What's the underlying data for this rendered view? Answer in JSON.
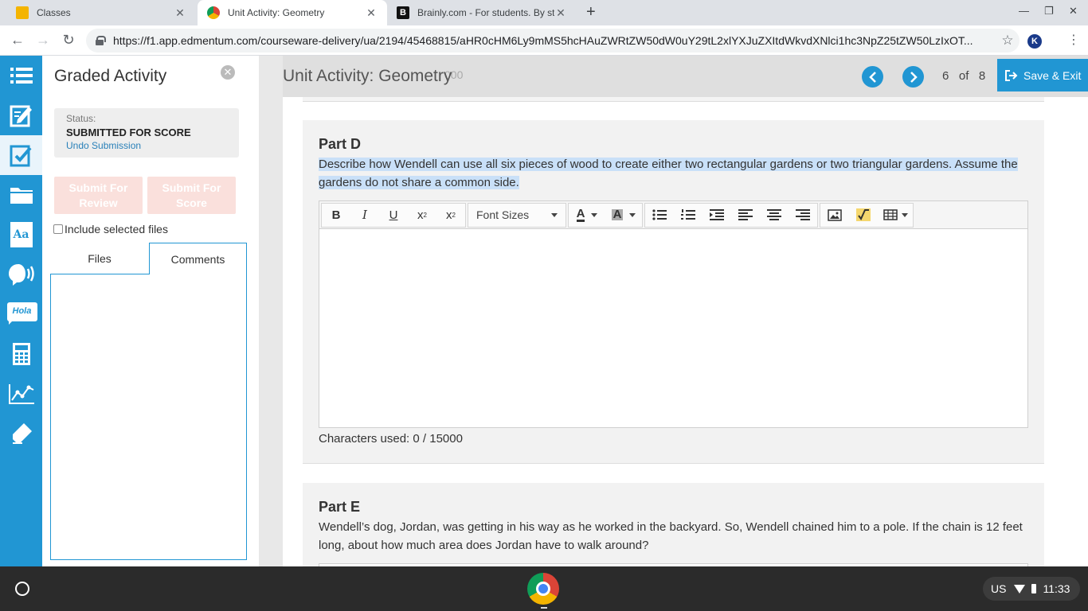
{
  "browser": {
    "tabs": [
      {
        "title": "Classes",
        "active": false
      },
      {
        "title": "Unit Activity: Geometry",
        "active": true
      },
      {
        "title": "Brainly.com - For students. By st",
        "active": false
      }
    ],
    "url": "https://f1.app.edmentum.com/courseware-delivery/ua/2194/45468815/aHR0cHM6Ly9mMS5hcHAuZWRtZW50dW0uY29tL2xlYXJuZXItdWkvdXNlci1hc3NpZ25tZW50LzIxOT...",
    "profile_initial": "K"
  },
  "rail": {
    "items": [
      "list-icon",
      "edit-icon",
      "graded-check-icon",
      "folder-icon",
      "dictionary-icon",
      "speech-icon",
      "translate-icon",
      "calculator-icon",
      "graph-icon",
      "highlighter-icon"
    ],
    "translate_badge": "Hola",
    "dictionary_badge": "Aa"
  },
  "panel": {
    "title": "Graded Activity",
    "close_glyph": "✕",
    "status_label": "Status:",
    "status_value": "SUBMITTED FOR SCORE",
    "undo_link": "Undo Submission",
    "submit_review": "Submit For Review",
    "submit_score": "Submit For Score",
    "include_label": "Include selected files",
    "tab_files": "Files",
    "tab_comments": "Comments"
  },
  "header": {
    "title": "Unit Activity: Geometry",
    "ghost_text": "000",
    "page_current": "6",
    "page_of": "of",
    "page_total": "8",
    "save_exit": "Save & Exit"
  },
  "part_d": {
    "title": "Part D",
    "prompt": "Describe how Wendell can use all six pieces of wood to create either two rectangular gardens or two triangular gardens. Assume the gardens do not share a common side.",
    "chars_used": "Characters used: 0 / 15000"
  },
  "editor": {
    "font_sizes_label": "Font Sizes"
  },
  "part_e": {
    "title": "Part E",
    "prompt": "Wendell’s dog, Jordan, was getting in his way as he worked in the backyard. So, Wendell chained him to a pole. If the chain is 12 feet long, about how much area does Jordan have to walk around?"
  },
  "taskbar": {
    "locale": "US",
    "time": "11:33"
  },
  "colors": {
    "accent": "#2196d3",
    "highlight": "#c9e0f8",
    "disabled_button": "#fae0dc"
  }
}
